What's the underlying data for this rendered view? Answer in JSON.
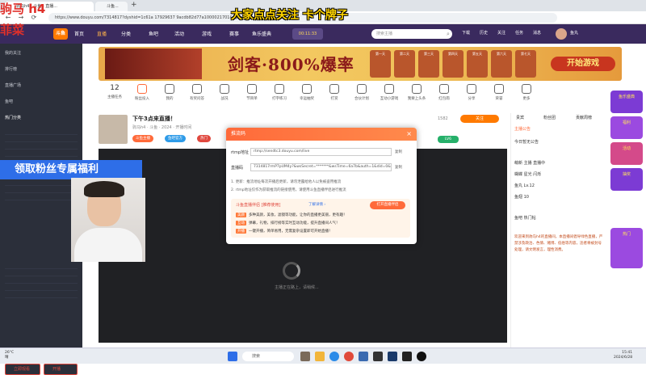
{
  "overlay": {
    "top_left_1": "驹马 h4",
    "top_left_2": "菲菜",
    "top_center": "大家点点关注 卡个牌子",
    "left_banner": "领取粉丝专属福利"
  },
  "browser": {
    "tab1": "驹马h4 | 斗鱼 - 直播...",
    "tab2": "斗鱼...",
    "url": "https://www.douyu.com/7314817?dyshid=1c61a 17929637 9acdb82d77a1000021701&dyshci=...",
    "back": "←",
    "forward": "→",
    "refresh": "⟳",
    "new_tab": "+"
  },
  "site_nav": {
    "logo": "斗鱼",
    "items": [
      "首页",
      "直播",
      "分类",
      "鱼吧",
      "活动",
      "游戏",
      "赛事",
      "鱼乐盛典"
    ],
    "countdown": "00:11:33",
    "search_placeholder": "搜索主播",
    "right_items": [
      "下载",
      "历史",
      "关注",
      "任务",
      "消息",
      "鱼丸"
    ]
  },
  "sidebar": {
    "items": [
      "我的关注",
      "排行榜",
      "直播广场",
      "鱼吧"
    ],
    "section": "热门分类",
    "bottom_buttons": [
      "立即观看",
      "开播"
    ]
  },
  "banner": {
    "text": "剑客·800%爆率",
    "button": "开始游戏",
    "items": [
      "第一天",
      "第二天",
      "第三天",
      "第四天",
      "第五天",
      "第六天",
      "第七天"
    ]
  },
  "icon_row": {
    "count": "12",
    "items": [
      "主播任务",
      "粉丝投入",
      "我的",
      "有奖问答",
      "战况",
      "节目单",
      "打字练习",
      "幸运抽奖",
      "打赏",
      "合伙计划",
      "互动小游戏",
      "我要上头条",
      "红包雨",
      "分享",
      "荣誉",
      "更多"
    ]
  },
  "stream": {
    "title": "下午3点来直播！",
    "subtitle": "驹马h4 · 斗鱼 · 2024 · 开播时间",
    "tags": [
      "斗鱼主播",
      "鱼吧官方",
      "热门"
    ],
    "level_badge": "LV6",
    "follow": "关注",
    "fans": "1582"
  },
  "dialog": {
    "title": "推流码",
    "close": "×",
    "server_label": "rtmp地址",
    "server_value": "rtmp://sendtc3.douyu.com/live",
    "stream_label": "直播码",
    "stream_value": "7314817rmP7pUM4y?&wsSecret=*******&wsTime=6a7b&auth=1&did=0&stream_id=1&cdn=...",
    "copy1": "复制",
    "copy2": "复制",
    "note1": "1. 更新：推流地址每次开播后更新，请勿泄露给他人以免被盗用推流",
    "note2": "2. rtmp地址仅作为获取推流的链接使用，请使用斗鱼直播伴侣进行推流",
    "promo_title": "斗鱼直播伴侣 [推荐使用]",
    "promo_link": "了解详情 ›",
    "promo_button": "打开直播伴侣",
    "promo_rows": [
      {
        "badge": "美颜",
        "text": "多种美颜，美妆，滤镜等功能，让你的直播更美丽，更有趣！"
      },
      {
        "badge": "互动",
        "text": "弹幕，礼物，排行榜等实时互动功能，提升直播间人气！"
      },
      {
        "badge": "开播",
        "text": "一键开播，简单易用，无需复杂设置即可开始直播！"
      }
    ]
  },
  "player": {
    "loading": "主播正在路上，请稍候..."
  },
  "right_panel": {
    "tabs": [
      "贵宾",
      "粉丝团",
      "贡献周榜"
    ],
    "header": "主播公告",
    "rows": [
      "今日暂无公告",
      "萌新 主播 直播中",
      "蝴蝶 星光 闪烁",
      "鱼丸 Lv.12",
      "鱼翅 10",
      "鱼吧 热门帖"
    ],
    "chat": "欢迎来到驹马h4的直播间，本直播间倡导绿色直播，严禁涉及政治、色情、赌博、低俗等内容，违者将被封号处理，请文明发言，理性消费。"
  },
  "right_ad": {
    "items": [
      "鱼乐盛典",
      "福利",
      "活动",
      "抽奖",
      "热门"
    ]
  },
  "taskbar": {
    "weather_temp": "26°C",
    "weather_text": "晴",
    "search": "搜索",
    "time": "15:41",
    "date": "2024/6/28"
  },
  "colors": {
    "site_nav": "#3a2a5e",
    "sidebar": "#2b2f3a",
    "accent": "#ff6a3a",
    "overlay_red": "#e0302a",
    "overlay_yellow": "#ffd400",
    "left_banner": "#2e6ee8"
  }
}
